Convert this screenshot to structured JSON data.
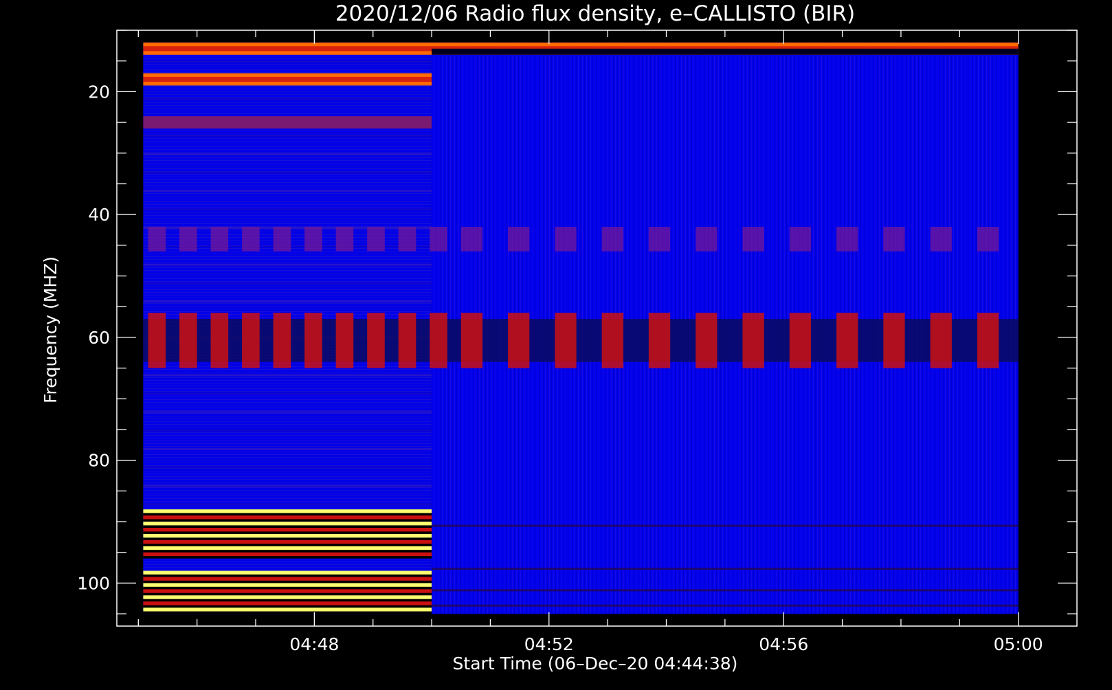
{
  "chart_data": {
    "type": "heatmap",
    "title": "2020/12/06  Radio flux density, e–CALLISTO (BIR)",
    "xlabel": "Start Time (06–Dec–20 04:44:38)",
    "ylabel": "Frequency (MHZ)",
    "x_ticks": [
      "04:48",
      "04:52",
      "04:56",
      "05:00"
    ],
    "y_ticks": [
      20,
      40,
      60,
      80,
      100
    ],
    "y_axis_inverted": true,
    "ylim": [
      10,
      107
    ],
    "xlim": [
      "04:44:38",
      "05:01"
    ],
    "data_extent": {
      "x_start": "04:45:05",
      "x_end": "05:00:00",
      "y_top": 12,
      "y_bottom": 105
    },
    "colormap": [
      "#000000",
      "#0000c8",
      "#3a1ad0",
      "#cc1010",
      "#ff6a00",
      "#ffff70"
    ],
    "background_color": "#0000f0",
    "regime_change_time": "04:50:00",
    "bands": [
      {
        "y0": 12,
        "y1": 14,
        "x0": "04:45:05",
        "x1": "05:00:00",
        "level": "orange"
      },
      {
        "y0": 17,
        "y1": 19,
        "x0": "04:45:05",
        "x1": "04:50:00",
        "level": "orange"
      },
      {
        "y0": 24,
        "y1": 26,
        "x0": "04:45:05",
        "x1": "04:50:00",
        "level": "dark-red"
      },
      {
        "y0": 57,
        "y1": 64,
        "x0": "04:45:05",
        "x1": "05:00:00",
        "level": "red-bursts"
      },
      {
        "y0": 88,
        "y1": 96,
        "x0": "04:45:05",
        "x1": "04:50:00",
        "level": "yellow"
      },
      {
        "y0": 98,
        "y1": 105,
        "x0": "04:45:05",
        "x1": "04:50:00",
        "level": "yellow"
      }
    ],
    "grid": false,
    "legend": "none"
  }
}
